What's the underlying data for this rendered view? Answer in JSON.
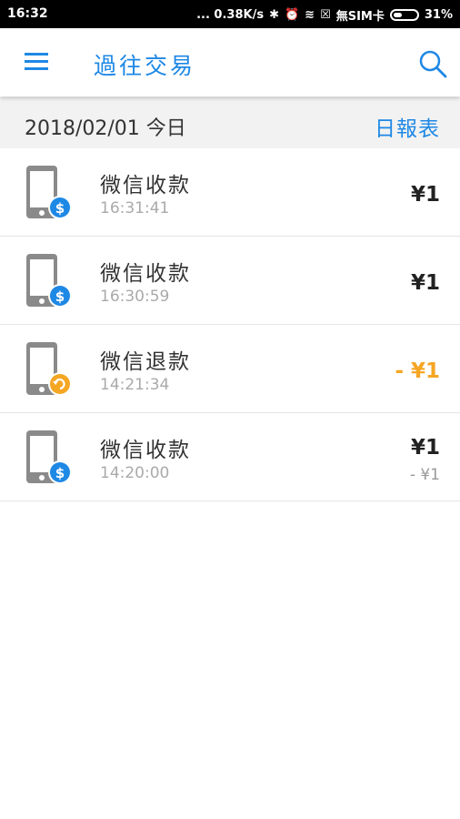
{
  "status": {
    "time": "16:32",
    "net_speed": "... 0.38K/s",
    "sim": "無SIM卡",
    "battery": "31%"
  },
  "appbar": {
    "title": "過往交易",
    "menu_icon": "hamburger-menu-icon",
    "search_icon": "search-icon"
  },
  "date_bar": {
    "date": "2018/02/01 今日",
    "report_label": "日報表"
  },
  "colors": {
    "accent": "#1e88e5",
    "refund": "#f5a623",
    "badge_blue": "#1e88e5"
  },
  "transactions": [
    {
      "name": "微信收款",
      "time": "16:31:41",
      "amount": "¥1",
      "sub": "",
      "type": "payment"
    },
    {
      "name": "微信收款",
      "time": "16:30:59",
      "amount": "¥1",
      "sub": "",
      "type": "payment"
    },
    {
      "name": "微信退款",
      "time": "14:21:34",
      "amount": "- ¥1",
      "sub": "",
      "type": "refund"
    },
    {
      "name": "微信收款",
      "time": "14:20:00",
      "amount": "¥1",
      "sub": "- ¥1",
      "type": "payment"
    }
  ]
}
